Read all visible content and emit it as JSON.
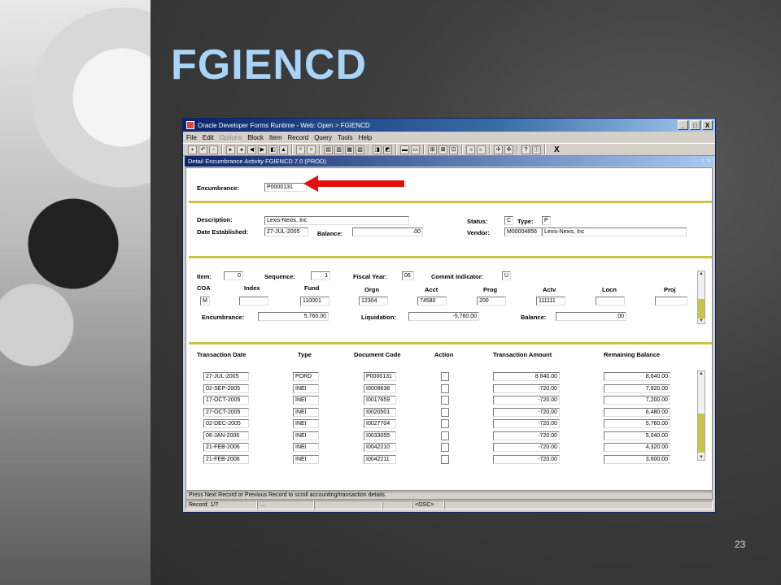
{
  "slide": {
    "title": "FGIENCD",
    "page_number": "23"
  },
  "window": {
    "title": "Oracle Developer Forms Runtime - Web:  Open > FGIENCD",
    "controls": [
      "_",
      "□",
      "X"
    ]
  },
  "menu": [
    {
      "label": "File",
      "enabled": true
    },
    {
      "label": "Edit",
      "enabled": true
    },
    {
      "label": "Options",
      "enabled": false
    },
    {
      "label": "Block",
      "enabled": true
    },
    {
      "label": "Item",
      "enabled": true
    },
    {
      "label": "Record",
      "enabled": true
    },
    {
      "label": "Query",
      "enabled": true
    },
    {
      "label": "Tools",
      "enabled": true
    },
    {
      "label": "Help",
      "enabled": true
    }
  ],
  "toolbar_exit": "X",
  "form": {
    "title": "Detail Encumbrance Activity  FGIENCD  7.0  (PROD)",
    "sub_controls": [
      "↑",
      "×"
    ],
    "encumbrance_label": "Encumbrance:",
    "encumbrance_value": "P0000131",
    "header": {
      "description_label": "Description:",
      "description_value": "Lexis-Nexis, Inc",
      "date_label": "Date Established:",
      "date_value": "27-JUL-2005",
      "balance_label": "Balance:",
      "balance_value": ".00",
      "status_label": "Status:",
      "status_value": "C",
      "type_label": "Type:",
      "type_value": "P",
      "vendor_label": "Vendor:",
      "vendor_id": "M00004856",
      "vendor_name": "Lexis-Nexis, Inc"
    },
    "accounting": {
      "item_label": "Item:",
      "item_value": "0",
      "sequence_label": "Sequence:",
      "sequence_value": "1",
      "fiscal_year_label": "Fiscal Year:",
      "fiscal_year_value": "06",
      "commit_label": "Commit Indicator:",
      "commit_value": "U",
      "col_coa": "COA",
      "col_index": "Index",
      "col_fund": "Fund",
      "col_orgn": "Orgn",
      "col_acct": "Acct",
      "col_prog": "Prog",
      "col_actv": "Actv",
      "col_locn": "Locn",
      "col_proj": "Proj",
      "coa": "M",
      "index": "",
      "fund": "110001",
      "orgn": "12304",
      "acct": "74580",
      "prog": "200",
      "actv": "111111",
      "locn": "",
      "proj": "",
      "encumbrance_label": "Encumbrance:",
      "encumbrance_value": "5,760.00",
      "liquidation_label": "Liquidation:",
      "liquidation_value": "-5,760.00",
      "balance_label": "Balance:",
      "balance_value": ".00"
    },
    "transactions": {
      "headers": [
        "Transaction Date",
        "Type",
        "Document Code",
        "Action",
        "Transaction Amount",
        "Remaining Balance"
      ],
      "rows": [
        {
          "date": "27-JUL-2005",
          "type": "PORD",
          "doc": "P0000131",
          "amount": "8,640.00",
          "remaining": "8,640.00"
        },
        {
          "date": "02-SEP-2005",
          "type": "INEI",
          "doc": "I0009638",
          "amount": "-720.00",
          "remaining": "7,920.00"
        },
        {
          "date": "17-OCT-2005",
          "type": "INEI",
          "doc": "I0017659",
          "amount": "-720.00",
          "remaining": "7,200.00"
        },
        {
          "date": "27-OCT-2005",
          "type": "INEI",
          "doc": "I0020501",
          "amount": "-720.00",
          "remaining": "6,480.00"
        },
        {
          "date": "02-DEC-2005",
          "type": "INEI",
          "doc": "I0027704",
          "amount": "-720.00",
          "remaining": "5,760.00"
        },
        {
          "date": "06-JAN-2006",
          "type": "INEI",
          "doc": "I0033055",
          "amount": "-720.00",
          "remaining": "5,040.00"
        },
        {
          "date": "21-FEB-2006",
          "type": "INEI",
          "doc": "I0042210",
          "amount": "-720.00",
          "remaining": "4,320.00"
        },
        {
          "date": "21-FEB-2006",
          "type": "INEI",
          "doc": "I0042211",
          "amount": "-720.00",
          "remaining": "3,600.00"
        }
      ]
    }
  },
  "status": {
    "hint": "Press Next Record or Previous Record to scroll accounting/transaction details",
    "record": "Record: 1/?",
    "ellipsis": "...",
    "osc": "<OSC>"
  },
  "colors": {
    "accent": "#c8c44a",
    "title_bar": "#0a246a",
    "slide_title": "#a8d4f8",
    "arrow": "#e01010"
  }
}
